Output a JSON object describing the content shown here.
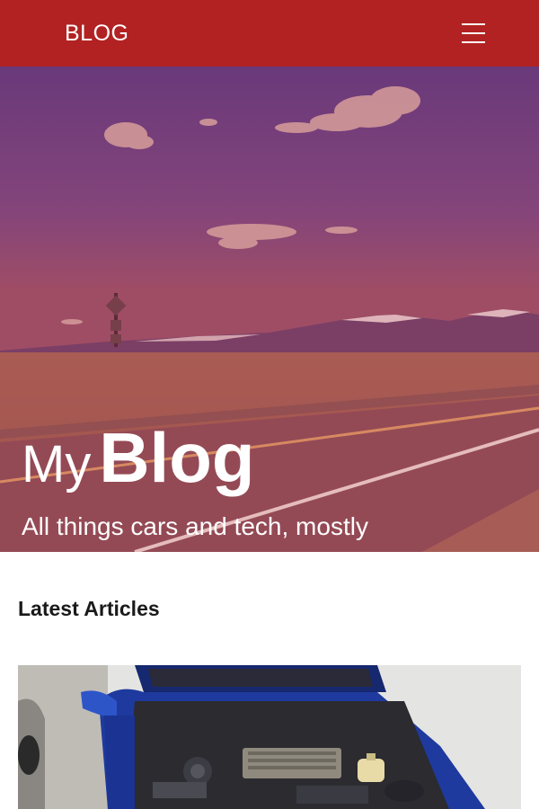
{
  "header": {
    "logo": "BLOG",
    "menu_icon": "hamburger-menu-icon",
    "background": "#b22222"
  },
  "hero": {
    "title_light": "My",
    "title_bold": "Blog",
    "subtitle": "All things cars and tech, mostly",
    "image": "road-landscape-image",
    "overlay_color": "#b22222"
  },
  "articles": {
    "heading": "Latest Articles",
    "items": [
      {
        "image": "car-engine-bay-image"
      }
    ]
  }
}
